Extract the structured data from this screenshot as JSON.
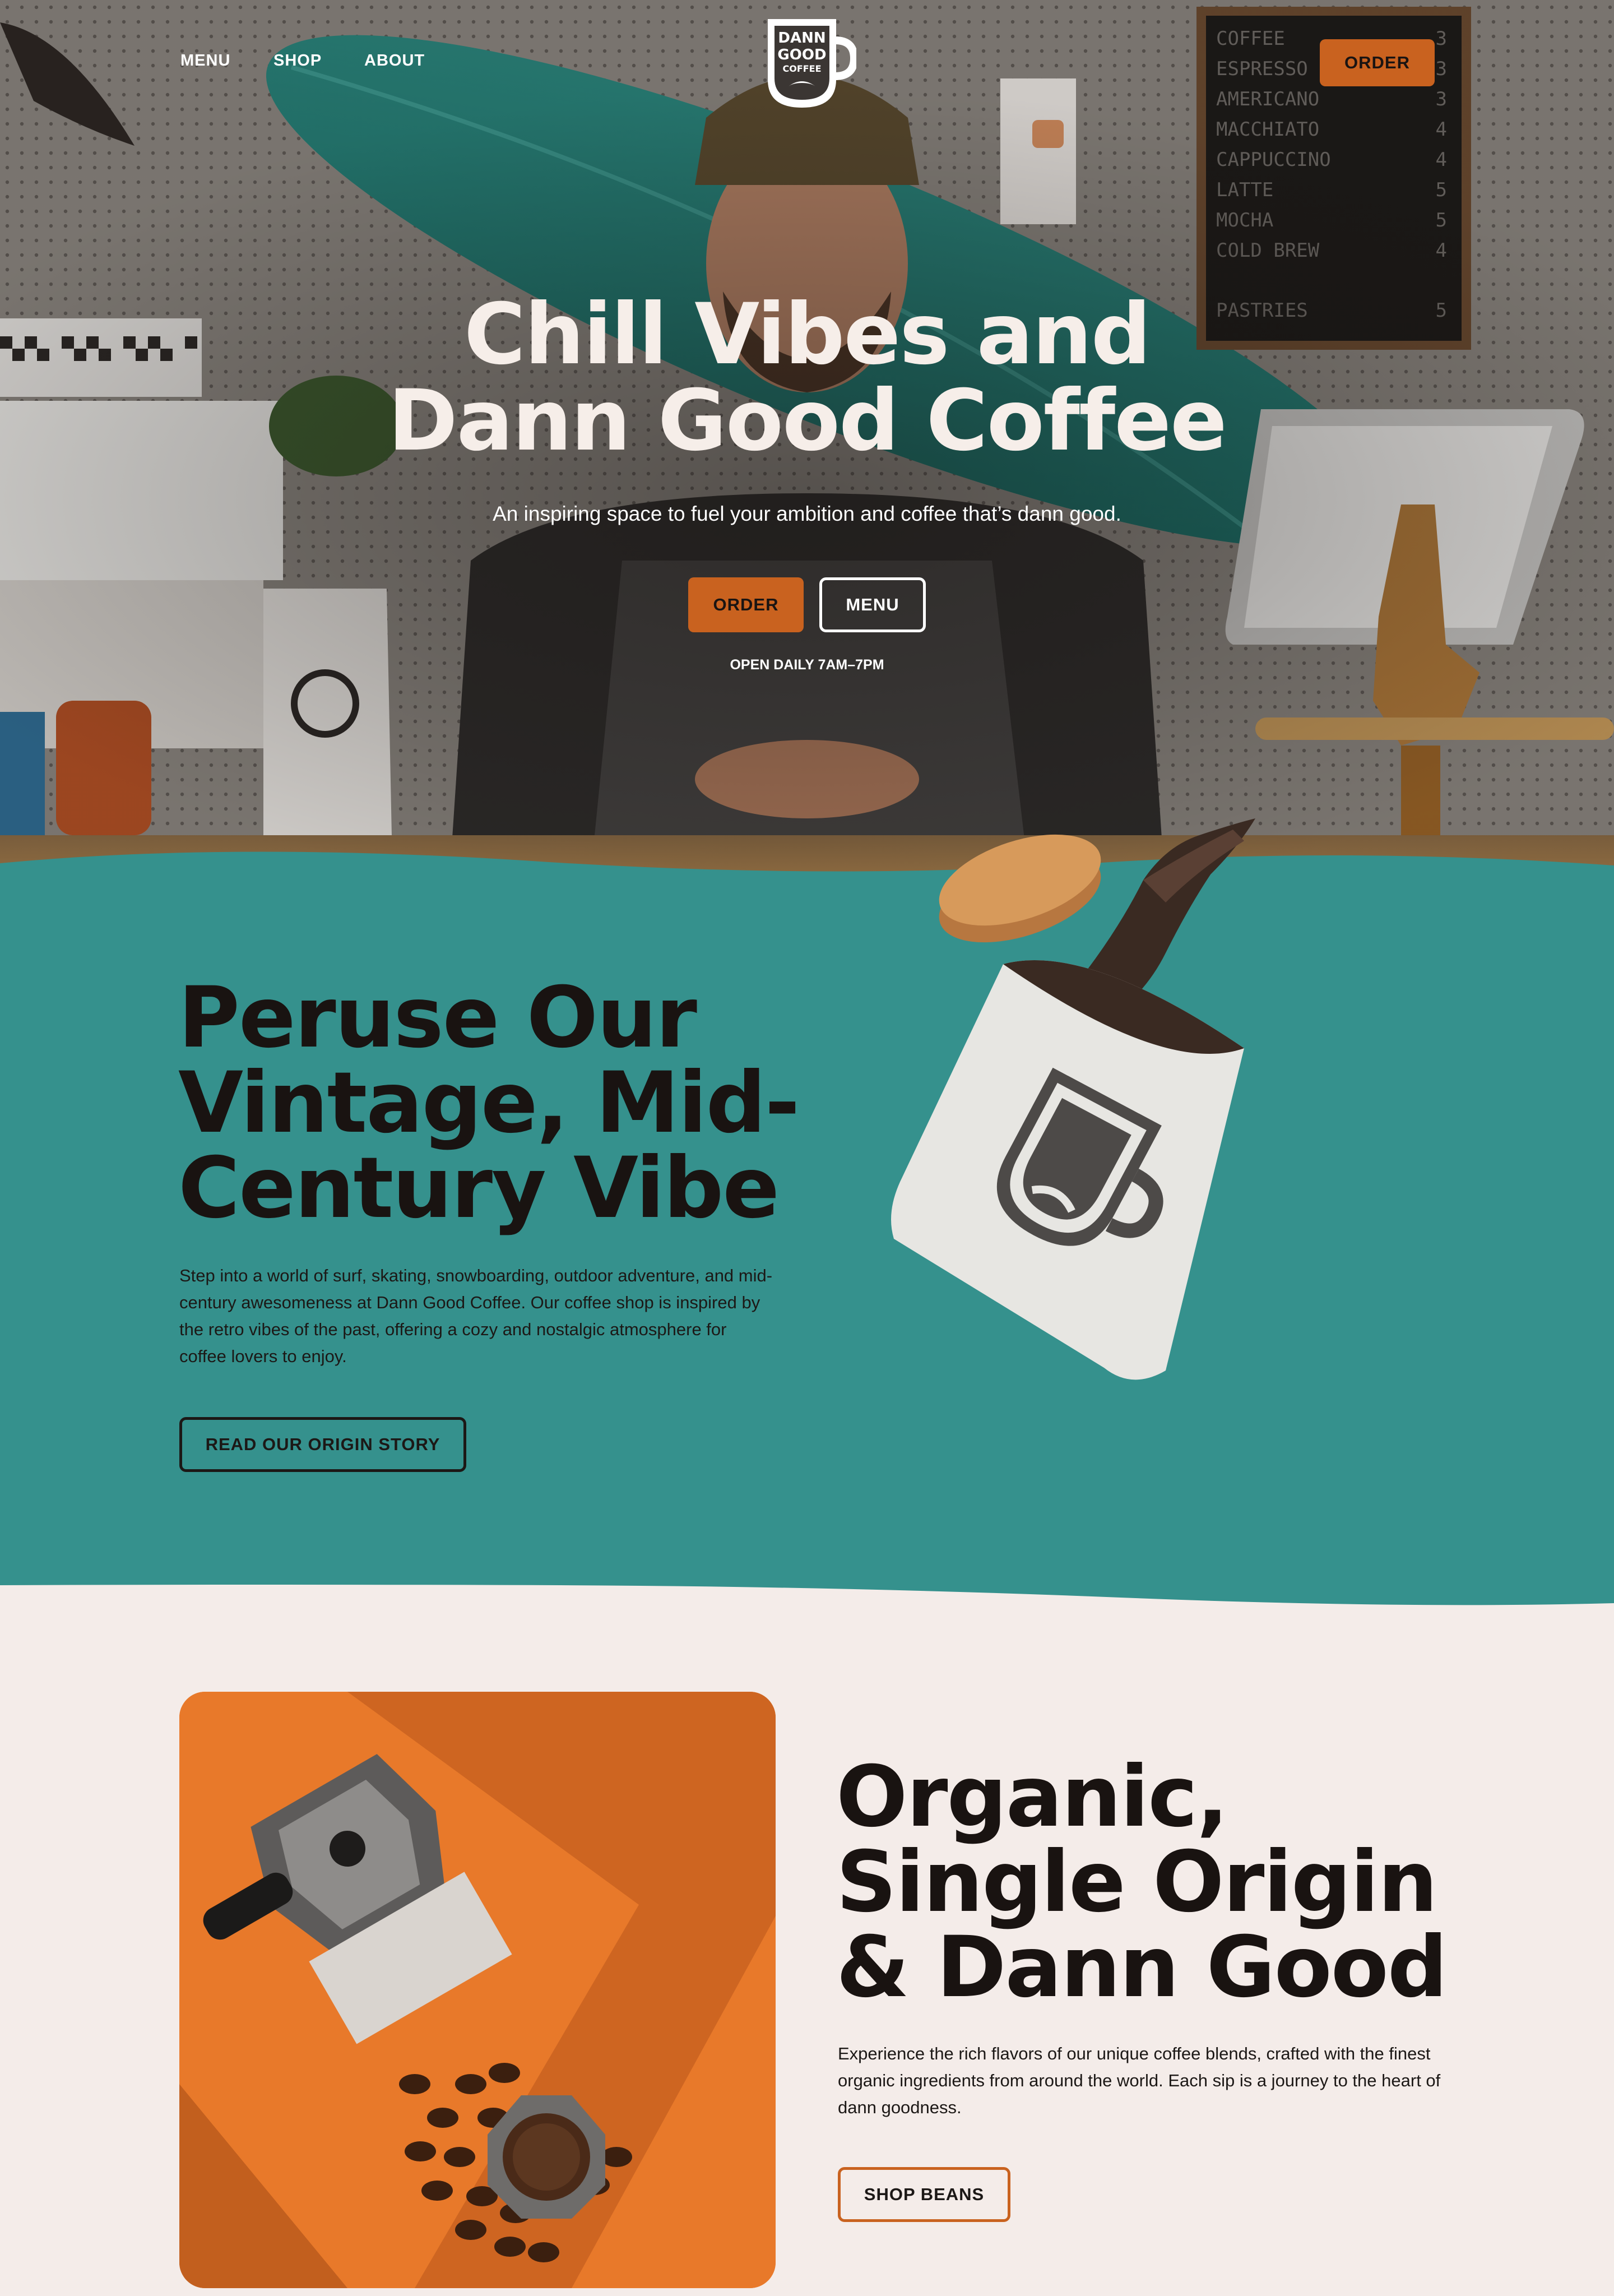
{
  "brand": {
    "logo_words": [
      "DANN",
      "GOOD",
      "COFFEE"
    ],
    "accent_color": "#c9621f",
    "teal_color": "#35918d",
    "cream_color": "#f4ece9",
    "dark_color": "#191311"
  },
  "nav": {
    "links": [
      {
        "label": "MENU"
      },
      {
        "label": "SHOP"
      },
      {
        "label": "ABOUT"
      }
    ],
    "order_label": "ORDER"
  },
  "hero": {
    "title": "Chill Vibes and\nDann Good Coffee",
    "subtitle": "An inspiring space to fuel your ambition and coffee that’s dann good.",
    "order_label": "ORDER",
    "menu_label": "MENU",
    "hours": "OPEN DAILY 7AM–7PM",
    "menu_board": [
      {
        "item": "COFFEE",
        "price": "3"
      },
      {
        "item": "ESPRESSO",
        "price": "3"
      },
      {
        "item": "AMERICANO",
        "price": "3"
      },
      {
        "item": "MACCHIATO",
        "price": "4"
      },
      {
        "item": "CAPPUCCINO",
        "price": "4"
      },
      {
        "item": "LATTE",
        "price": "5"
      },
      {
        "item": "MOCHA",
        "price": "5"
      },
      {
        "item": "COLD BREW",
        "price": "4"
      },
      {
        "item": "PASTRIES",
        "price": "5"
      }
    ]
  },
  "vibe": {
    "title": "Peruse Our\nVintage, Mid-\nCentury Vibe",
    "body": "Step into a world of surf, skating, snowboarding, outdoor adventure, and mid-century awesomeness at Dann Good Coffee. Our coffee shop is inspired by the retro vibes of the past, offering a cozy and nostalgic atmosphere for coffee lovers to enjoy.",
    "button_label": "READ OUR ORIGIN STORY"
  },
  "origin": {
    "title": "Organic,\nSingle Origin\n& Dann Good",
    "body": "Experience the rich flavors of our unique coffee blends, crafted with the finest organic ingredients from around the world. Each sip is a journey to the heart of dann goodness.",
    "button_label": "SHOP BEANS"
  }
}
